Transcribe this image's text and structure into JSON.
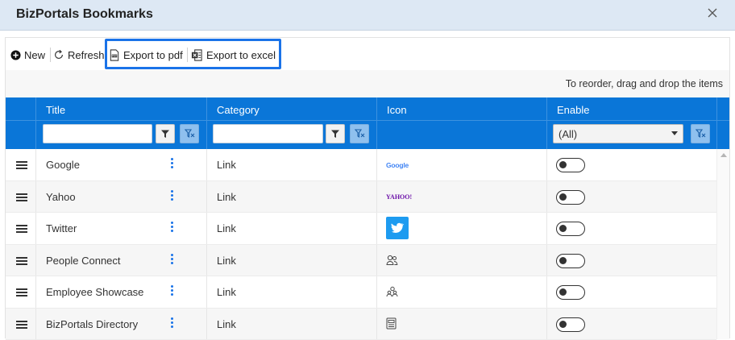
{
  "dialog": {
    "title": "BizPortals Bookmarks",
    "close_icon": "close-icon"
  },
  "toolbar": {
    "new_label": "New",
    "refresh_label": "Refresh",
    "export_pdf_label": "Export to pdf",
    "export_excel_label": "Export to excel",
    "highlight_color": "#1a73e8"
  },
  "hint": "To reorder, drag and drop the items",
  "grid": {
    "header_color": "#0a76d8",
    "columns": {
      "title": "Title",
      "category": "Category",
      "icon": "Icon",
      "enable": "Enable"
    },
    "enable_filter_value": "(All)",
    "rows": [
      {
        "title": "Google",
        "category": "Link",
        "icon": "google-logo-icon",
        "enabled": false
      },
      {
        "title": "Yahoo",
        "category": "Link",
        "icon": "yahoo-logo-icon",
        "enabled": false
      },
      {
        "title": "Twitter",
        "category": "Link",
        "icon": "twitter-logo-icon",
        "enabled": false
      },
      {
        "title": "People Connect",
        "category": "Link",
        "icon": "people-icon",
        "enabled": false
      },
      {
        "title": "Employee Showcase",
        "category": "Link",
        "icon": "employee-showcase-icon",
        "enabled": false
      },
      {
        "title": "BizPortals Directory",
        "category": "Link",
        "icon": "directory-icon",
        "enabled": false
      }
    ]
  },
  "logos": {
    "google": "Google",
    "yahoo": "YAHOO!"
  }
}
